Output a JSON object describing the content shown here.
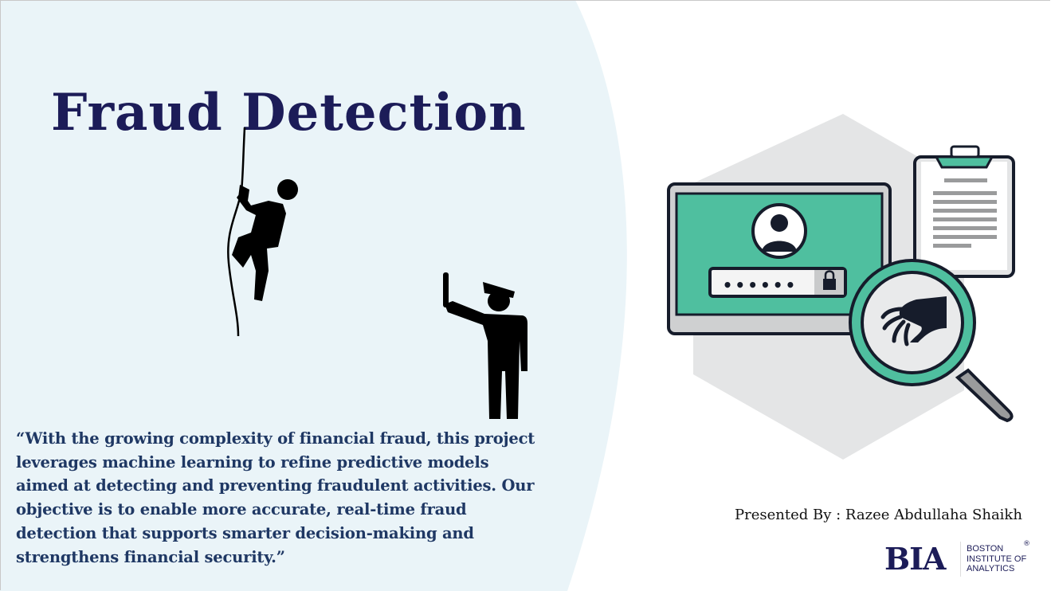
{
  "slide": {
    "title": "Fraud Detection",
    "quote_lines": [
      "“With the growing complexity of financial fraud, this project",
      "leverages machine learning to refine predictive models",
      "aimed at detecting and preventing fraudulent activities. Our",
      "objective is to enable more accurate, real-time fraud",
      "detection that supports smarter decision-making and",
      "strengthens financial security.”"
    ],
    "presenter": "Presented By : Razee Abdullaha Shaikh"
  },
  "logo": {
    "mark": "BIA",
    "name_lines": [
      "BOSTON",
      "INSTITUTE OF",
      "ANALYTICS"
    ],
    "registered": "®"
  },
  "colors": {
    "title": "#1c1c58",
    "quote": "#1f3864",
    "panel": "#eaf4f8",
    "accent_green": "#4fbf9f",
    "dark": "#161c2b"
  },
  "illustration": {
    "password_mask": "••••••",
    "icons": [
      "climbing-thief-icon",
      "police-officer-icon",
      "monitor-login-icon",
      "clipboard-icon",
      "magnifier-hand-icon"
    ]
  }
}
